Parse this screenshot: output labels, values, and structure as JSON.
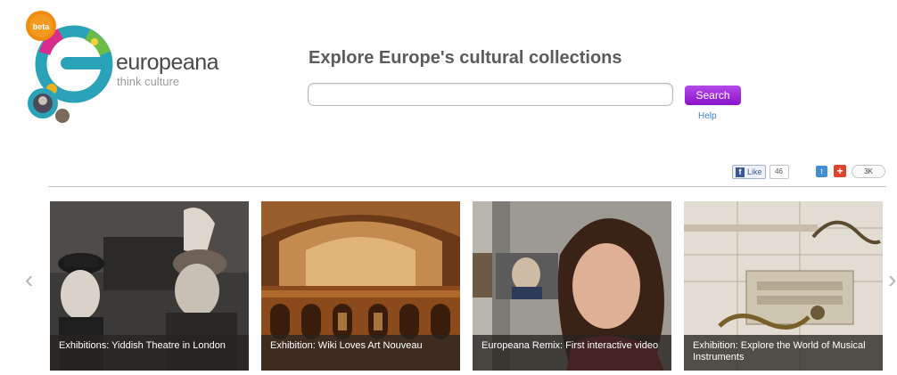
{
  "logo": {
    "wordmark": "europeana",
    "tagline": "think culture",
    "badge": "beta"
  },
  "search": {
    "title": "Explore Europe's cultural collections",
    "value": "",
    "placeholder": "",
    "button_label": "Search",
    "help_label": "Help"
  },
  "social": {
    "fb_label": "Like",
    "fb_count": "46",
    "share_count": "3K"
  },
  "carousel": {
    "prev_icon": "chevron-left-icon",
    "next_icon": "chevron-right-icon",
    "items": [
      {
        "caption": "Exhibitions: Yiddish Theatre in London"
      },
      {
        "caption": "Exhibition: Wiki Loves Art Nouveau"
      },
      {
        "caption": "Europeana Remix: First interactive video"
      },
      {
        "caption": "Exhibition: Explore the World of Musical Instruments"
      }
    ]
  },
  "colors": {
    "search_button": "#9b23dc",
    "help_link": "#3b7fd9",
    "logo_sun": "#f08a10",
    "logo_teal": "#2aa3b8",
    "logo_pink": "#d82d8c"
  }
}
